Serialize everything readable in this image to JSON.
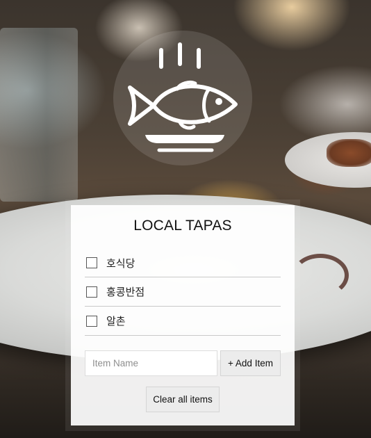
{
  "app": {
    "title": "LOCAL TAPAS",
    "logo_icon": "steaming-fish-on-plate-icon"
  },
  "items": [
    {
      "label": "호식당",
      "checked": false
    },
    {
      "label": "홍콩반점",
      "checked": false
    },
    {
      "label": "알촌",
      "checked": false
    }
  ],
  "form": {
    "input_value": "",
    "input_placeholder": "Item Name",
    "add_label": "+ Add Item",
    "clear_label": "Clear all items"
  },
  "colors": {
    "card_background": "#ffffff",
    "button_background": "#ececec",
    "divider": "#c9c9c9"
  }
}
